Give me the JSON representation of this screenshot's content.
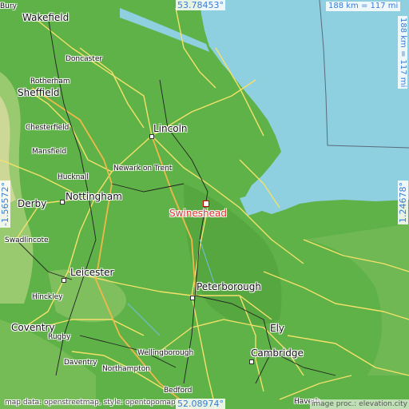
{
  "map": {
    "place_name": "Swineshead",
    "colors": {
      "sea": "#8ecfe0",
      "land": "#5fb247",
      "highland": "#c7d99a",
      "road": "#f3e26a",
      "target": "#e23030"
    },
    "coordinates": {
      "north": "53.78453°",
      "south": "52.08974°",
      "west": "-1.56572°",
      "east": "1.24678°"
    },
    "scale": {
      "horizontal": "188 km = 117 mi",
      "vertical": "188 km = 117 mi"
    },
    "cities": {
      "wakefield": "Wakefield",
      "doncaster": "Doncaster",
      "rotherham": "Rotherham",
      "sheffield": "Sheffield",
      "chesterfield": "Chesterfield",
      "lincoln": "Lincoln",
      "mansfield": "Mansfield",
      "newark": "Newark on Trent",
      "hucknall": "Hucknall",
      "nottingham": "Nottingham",
      "derby": "Derby",
      "swadlincote": "Swadlincote",
      "leicester": "Leicester",
      "peterborough": "Peterborough",
      "hinckley": "Hinckley",
      "coventry": "Coventry",
      "rugby": "Rugby",
      "ely": "Ely",
      "wellingborough": "Wellingborough",
      "daventry": "Daventry",
      "northampton": "Northampton",
      "cambridge": "Cambridge",
      "bedford": "Bedford",
      "haverhill": "Haverh",
      "bury": "Bury"
    },
    "attribution": "map data: openstreetmap, style: opentopomap",
    "attribution_right": "image proc.: elevation.city"
  }
}
